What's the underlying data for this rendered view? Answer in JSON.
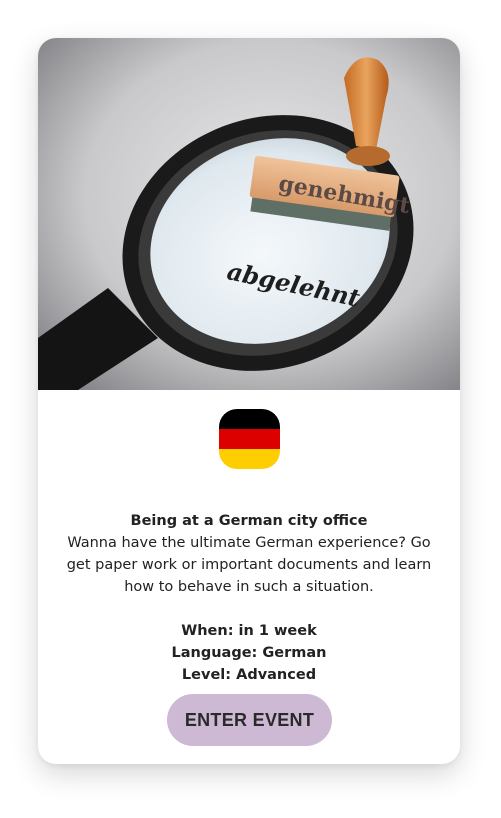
{
  "hero": {
    "stamp_text": "genehmigt",
    "paper_text": "abgelehnt"
  },
  "flag": {
    "colors": [
      "#000000",
      "#dd0000",
      "#ffce00"
    ]
  },
  "event": {
    "title": "Being at a German city office",
    "description": "Wanna have the ultimate German experience? Go get paper work or important documents and learn how to behave in such a situation.",
    "when": "When: in 1 week",
    "language": "Language: German",
    "level": "Level: Advanced"
  },
  "button": {
    "label": "ENTER EVENT",
    "color": "#cdb9d4"
  }
}
